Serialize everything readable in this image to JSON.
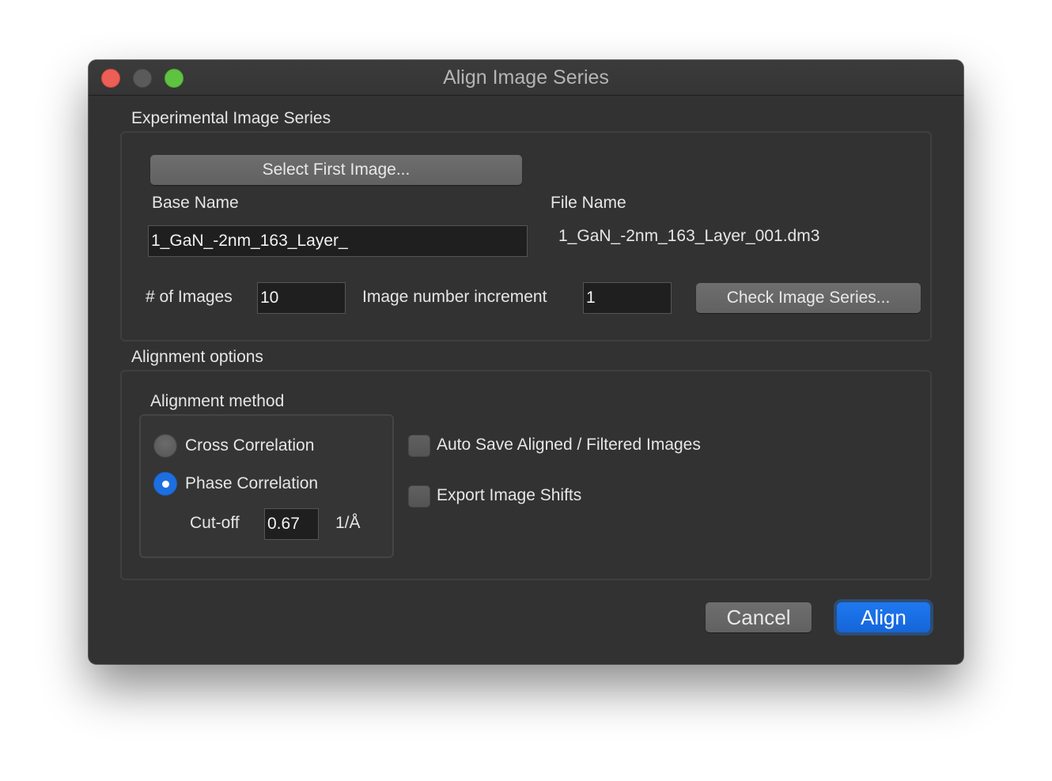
{
  "window": {
    "title": "Align Image Series",
    "traffic_lights": [
      "close",
      "minimize",
      "zoom"
    ]
  },
  "experimental_series": {
    "section_title": "Experimental Image Series",
    "select_first_image_label": "Select First Image...",
    "base_name_label": "Base Name",
    "base_name_value": "1_GaN_-2nm_163_Layer_",
    "file_name_label": "File Name",
    "file_name_value": "1_GaN_-2nm_163_Layer_001.dm3",
    "num_images_label": "# of Images",
    "num_images_value": "10",
    "increment_label": "Image number increment",
    "increment_value": "1",
    "check_series_label": "Check Image Series..."
  },
  "alignment_options": {
    "section_title": "Alignment options",
    "method_title": "Alignment method",
    "cross_correlation_label": "Cross Correlation",
    "cross_correlation_selected": false,
    "phase_correlation_label": "Phase Correlation",
    "phase_correlation_selected": true,
    "cutoff_label": "Cut-off",
    "cutoff_value": "0.67",
    "cutoff_unit": "1/Å",
    "auto_save_label": "Auto Save Aligned / Filtered Images",
    "auto_save_checked": false,
    "export_shifts_label": "Export Image Shifts",
    "export_shifts_checked": false
  },
  "footer": {
    "cancel_label": "Cancel",
    "align_label": "Align"
  },
  "colors": {
    "window_bg": "#323232",
    "accent": "#1d6fe0",
    "close": "#ec5f57",
    "zoom": "#5fc240"
  }
}
